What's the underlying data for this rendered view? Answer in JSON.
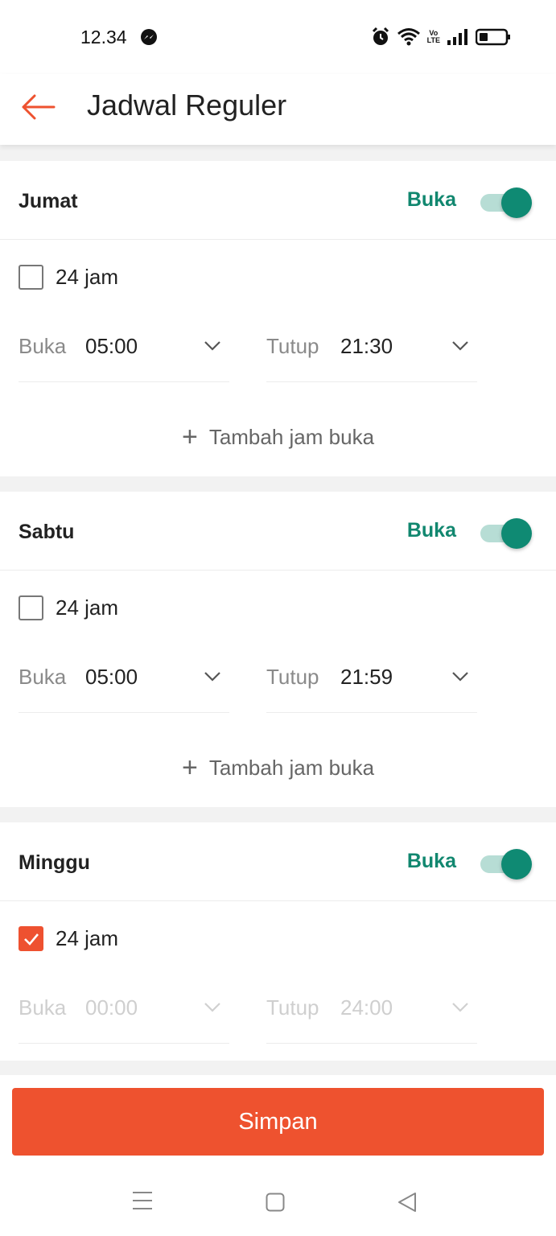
{
  "status_bar": {
    "time": "12.34",
    "icons": [
      "messenger-icon",
      "alarm-icon",
      "wifi-icon",
      "volte-icon",
      "signal-icon",
      "battery-icon"
    ],
    "volte_top": "Vo",
    "volte_bottom": "LTE"
  },
  "header": {
    "title": "Jadwal Reguler",
    "back_icon": "arrow-left-icon"
  },
  "colors": {
    "accent": "#ee522f",
    "open_green": "#11876f",
    "toggle_track": "#b7ddd5"
  },
  "days": [
    {
      "name": "Jumat",
      "status": "Buka",
      "toggle_on": true,
      "all_day_label": "24 jam",
      "all_day_checked": false,
      "open_label": "Buka",
      "open_time": "05:00",
      "close_label": "Tutup",
      "close_time": "21:30",
      "add_label": "Tambah jam buka"
    },
    {
      "name": "Sabtu",
      "status": "Buka",
      "toggle_on": true,
      "all_day_label": "24 jam",
      "all_day_checked": false,
      "open_label": "Buka",
      "open_time": "05:00",
      "close_label": "Tutup",
      "close_time": "21:59",
      "add_label": "Tambah jam buka"
    },
    {
      "name": "Minggu",
      "status": "Buka",
      "toggle_on": true,
      "all_day_label": "24 jam",
      "all_day_checked": true,
      "open_label": "Buka",
      "open_time": "00:00",
      "close_label": "Tutup",
      "close_time": "24:00"
    }
  ],
  "footer": {
    "save_label": "Simpan"
  },
  "nav_bar": {
    "icons": [
      "menu-icon",
      "home-icon",
      "back-triangle-icon"
    ]
  }
}
